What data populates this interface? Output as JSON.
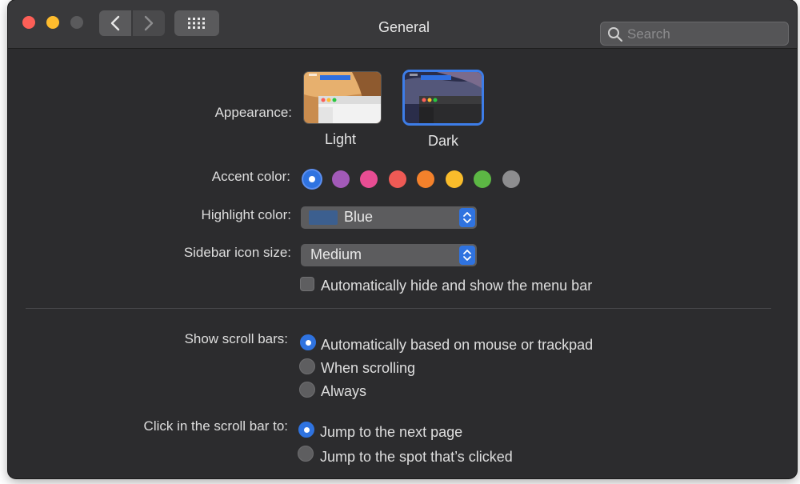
{
  "window": {
    "title": "General"
  },
  "search": {
    "placeholder": "Search"
  },
  "appearance": {
    "label": "Appearance:",
    "options": [
      {
        "name": "Light",
        "selected": false
      },
      {
        "name": "Dark",
        "selected": true
      }
    ]
  },
  "accent": {
    "label": "Accent color:",
    "colors": [
      "#2f73e0",
      "#a25ab8",
      "#e84d93",
      "#ee5a55",
      "#f3812b",
      "#f9bc2b",
      "#5cb744",
      "#8d8d8f"
    ],
    "selected_index": 0
  },
  "highlight": {
    "label": "Highlight color:",
    "value": "Blue",
    "swatch_color": "#3c5f8f"
  },
  "sidebar_icon_size": {
    "label": "Sidebar icon size:",
    "value": "Medium"
  },
  "menu_bar": {
    "label": "Automatically hide and show the menu bar",
    "checked": false
  },
  "scroll_bars": {
    "label": "Show scroll bars:",
    "options": [
      "Automatically based on mouse or trackpad",
      "When scrolling",
      "Always"
    ],
    "selected_index": 0
  },
  "click_scroll": {
    "label": "Click in the scroll bar to:",
    "options": [
      "Jump to the next page",
      "Jump to the spot that’s clicked"
    ],
    "selected_index": 0
  },
  "colors": {
    "accent_blue": "#2f73e0",
    "background": "#2c2c2e",
    "titlebar": "#39393b"
  }
}
